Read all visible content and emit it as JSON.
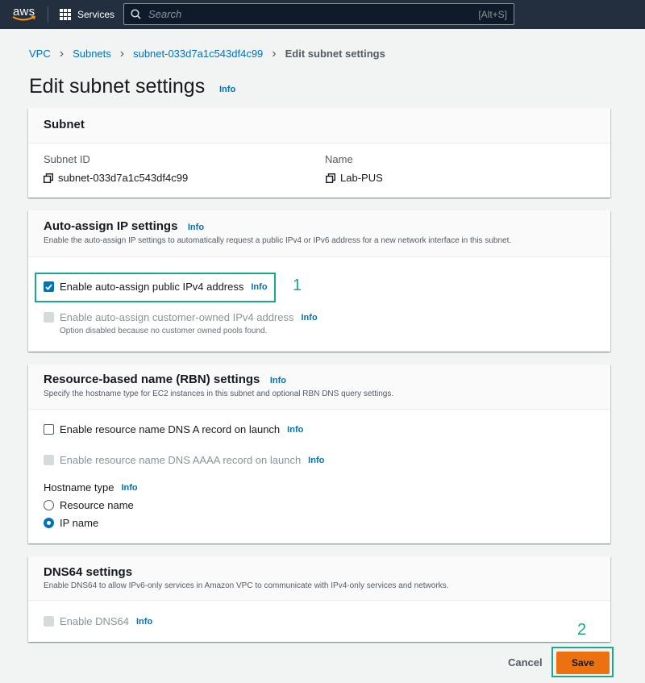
{
  "nav": {
    "logo_text": "aws",
    "services_label": "Services",
    "search_placeholder": "Search",
    "search_shortcut": "[Alt+S]"
  },
  "breadcrumb": [
    {
      "label": "VPC"
    },
    {
      "label": "Subnets"
    },
    {
      "label": "subnet-033d7a1c543df4c99"
    },
    {
      "label": "Edit subnet settings"
    }
  ],
  "page": {
    "title": "Edit subnet settings",
    "info": "Info"
  },
  "subnet_panel": {
    "header": "Subnet",
    "subnet_id_label": "Subnet ID",
    "subnet_id_value": "subnet-033d7a1c543df4c99",
    "name_label": "Name",
    "name_value": "Lab-PUS"
  },
  "auto_assign_panel": {
    "header": "Auto-assign IP settings",
    "info": "Info",
    "description": "Enable the auto-assign IP settings to automatically request a public IPv4 or IPv6 address for a new network interface in this subnet.",
    "ipv4_label": "Enable auto-assign public IPv4 address",
    "ipv4_checked": true,
    "ipv4_info": "Info",
    "customer_owned_label": "Enable auto-assign customer-owned IPv4 address",
    "customer_owned_info": "Info",
    "customer_owned_note": "Option disabled because no customer owned pools found."
  },
  "rbn_panel": {
    "header": "Resource-based name (RBN) settings",
    "info": "Info",
    "description": "Specify the hostname type for EC2 instances in this subnet and optional RBN DNS query settings.",
    "dns_a_label": "Enable resource name DNS A record on launch",
    "dns_a_info": "Info",
    "dns_aaaa_label": "Enable resource name DNS AAAA record on launch",
    "dns_aaaa_info": "Info",
    "hostname_type_label": "Hostname type",
    "hostname_type_info": "Info",
    "hostname_options": [
      "Resource name",
      "IP name"
    ],
    "hostname_selected": "IP name"
  },
  "dns64_panel": {
    "header": "DNS64 settings",
    "description": "Enable DNS64 to allow IPv6-only services in Amazon VPC to communicate with IPv4-only services and networks.",
    "dns64_label": "Enable DNS64",
    "dns64_info": "Info"
  },
  "annotations": [
    "1",
    "2"
  ],
  "actions": {
    "cancel": "Cancel",
    "save": "Save"
  },
  "colors": {
    "nav_bg": "#232f3e",
    "link": "#0073bb",
    "primary_button": "#ec7211",
    "annotation": "#1aa88e"
  }
}
